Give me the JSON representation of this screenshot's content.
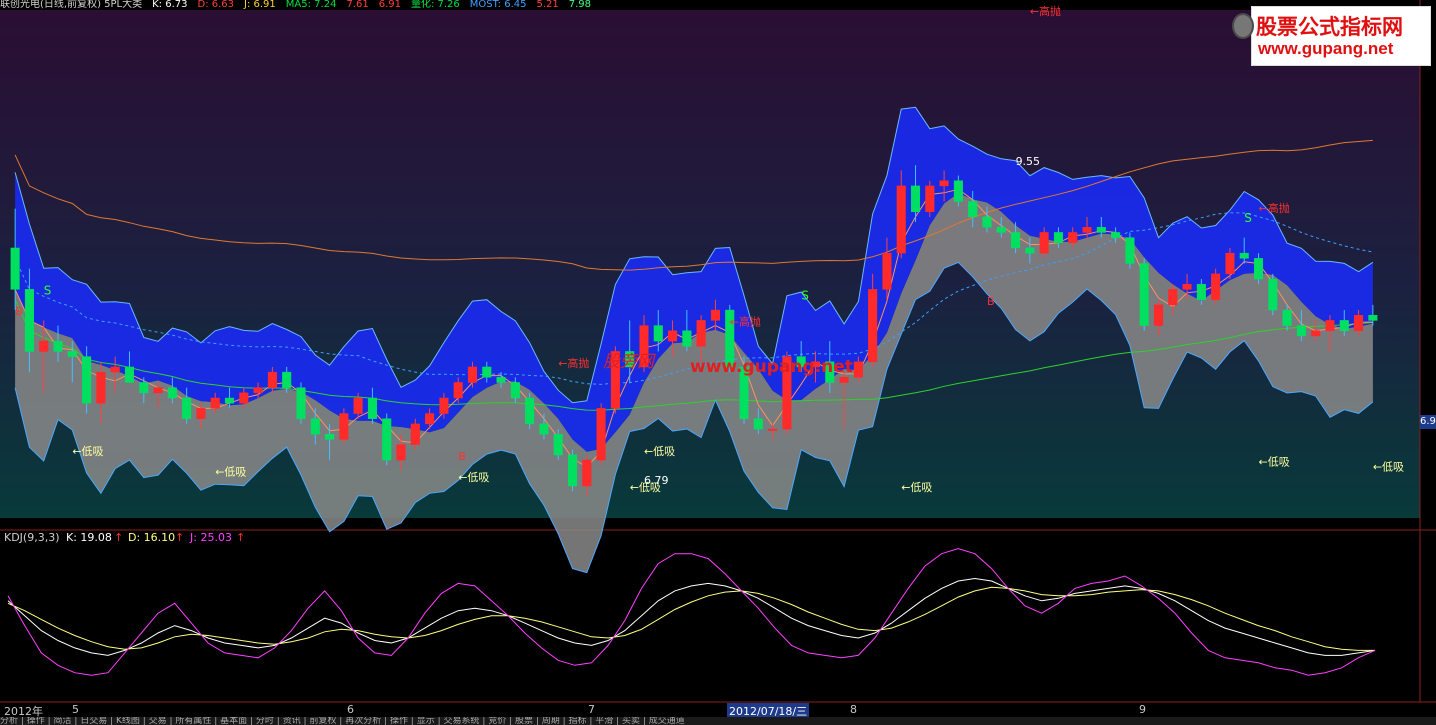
{
  "header": {
    "items": [
      {
        "text": "联创光电(日线,前复权) 5PL大类",
        "color": "#d0d0d0"
      },
      {
        "text": "K: 6.73",
        "color": "#ffffff"
      },
      {
        "text": "D: 6.63",
        "color": "#ff4040"
      },
      {
        "text": "J: 6.91",
        "color": "#ffd040"
      },
      {
        "text": "MA5: 7.24",
        "color": "#00e040"
      },
      {
        "text": "7.61",
        "color": "#ff4040"
      },
      {
        "text": "6.91",
        "color": "#ff4040"
      },
      {
        "text": "量化: 7.26",
        "color": "#00e040"
      },
      {
        "text": "MOST: 6.45",
        "color": "#40a0ff"
      },
      {
        "text": "5.21",
        "color": "#ff4040"
      },
      {
        "text": "7.98",
        "color": "#40ff80"
      }
    ]
  },
  "watermark": {
    "line1": "股票公式指标网",
    "line2": "www.gupang.net"
  },
  "center_watermark": {
    "cn": "股旁网",
    "url": "www.gupang.net"
  },
  "price_box": "6.9",
  "axis_labels": [
    {
      "text": "2012年"
    },
    {
      "text": "5"
    },
    {
      "text": "6"
    },
    {
      "text": "7"
    },
    {
      "text": "2012/07/18/三",
      "highlight": true
    },
    {
      "text": "8"
    },
    {
      "text": "9"
    }
  ],
  "bottom_bar": "分析 | 操作 | 简洁 | 日交易 | K线图 | 交易 | 所有属性 | 基本面 | 分时 | 资讯 | 前复权 | 再次分析 | 操作 | 显示 | 交易系统 | 竞价 | 股票 | 周期 | 指标 | 平滑 | 买卖 | 成交通道",
  "kdj": {
    "title": "KDJ(9,3,3)",
    "k_label": "K: 19.08",
    "k_color": "#ffffff",
    "d_label": "D: 16.10",
    "d_color": "#ffff80",
    "j_label": "J: 25.03",
    "j_color": "#ff40ff",
    "up_arrow": "↑"
  },
  "chart_data": [
    {
      "type": "line",
      "subtype": "candlestick",
      "title": "联创光电(日线,前复权)",
      "note_values": "price series estimated from screenshot",
      "candles": [
        [
          7.6,
          7.98,
          7.0,
          7.2
        ],
        [
          7.2,
          7.4,
          6.4,
          6.6
        ],
        [
          6.6,
          6.9,
          6.2,
          6.7
        ],
        [
          6.7,
          6.85,
          6.5,
          6.6
        ],
        [
          6.6,
          6.7,
          6.3,
          6.55
        ],
        [
          6.55,
          6.65,
          6.0,
          6.1
        ],
        [
          6.1,
          6.5,
          5.9,
          6.4
        ],
        [
          6.4,
          6.55,
          6.2,
          6.45
        ],
        [
          6.45,
          6.6,
          6.3,
          6.3
        ],
        [
          6.3,
          6.35,
          6.1,
          6.2
        ],
        [
          6.2,
          6.3,
          6.05,
          6.25
        ],
        [
          6.25,
          6.35,
          6.1,
          6.15
        ],
        [
          6.15,
          6.25,
          5.9,
          5.95
        ],
        [
          5.95,
          6.1,
          5.85,
          6.05
        ],
        [
          6.05,
          6.2,
          6.0,
          6.15
        ],
        [
          6.15,
          6.25,
          6.05,
          6.1
        ],
        [
          6.1,
          6.25,
          6.05,
          6.2
        ],
        [
          6.2,
          6.3,
          6.15,
          6.25
        ],
        [
          6.25,
          6.45,
          6.2,
          6.4
        ],
        [
          6.4,
          6.45,
          6.2,
          6.25
        ],
        [
          6.25,
          6.3,
          5.9,
          5.95
        ],
        [
          5.95,
          6.05,
          5.7,
          5.8
        ],
        [
          5.8,
          5.9,
          5.55,
          5.75
        ],
        [
          5.75,
          6.05,
          5.7,
          6.0
        ],
        [
          6.0,
          6.2,
          5.95,
          6.15
        ],
        [
          6.15,
          6.25,
          5.9,
          5.95
        ],
        [
          5.95,
          6.0,
          5.5,
          5.55
        ],
        [
          5.55,
          5.8,
          5.45,
          5.7
        ],
        [
          5.7,
          5.95,
          5.65,
          5.9
        ],
        [
          5.9,
          6.05,
          5.85,
          6.0
        ],
        [
          6.0,
          6.2,
          5.95,
          6.15
        ],
        [
          6.15,
          6.35,
          6.1,
          6.3
        ],
        [
          6.3,
          6.5,
          6.25,
          6.45
        ],
        [
          6.45,
          6.5,
          6.3,
          6.35
        ],
        [
          6.35,
          6.4,
          6.25,
          6.3
        ],
        [
          6.3,
          6.35,
          6.1,
          6.15
        ],
        [
          6.15,
          6.2,
          5.85,
          5.9
        ],
        [
          5.9,
          6.0,
          5.75,
          5.8
        ],
        [
          5.8,
          5.85,
          5.55,
          5.6
        ],
        [
          5.6,
          5.65,
          5.25,
          5.3
        ],
        [
          5.3,
          5.6,
          5.2,
          5.55
        ],
        [
          5.55,
          6.1,
          5.5,
          6.05
        ],
        [
          6.05,
          6.65,
          6.0,
          6.6
        ],
        [
          6.6,
          6.9,
          6.3,
          6.45
        ],
        [
          6.45,
          6.95,
          6.4,
          6.85
        ],
        [
          6.85,
          7.0,
          6.6,
          6.7
        ],
        [
          6.7,
          6.9,
          6.55,
          6.8
        ],
        [
          6.8,
          7.0,
          6.6,
          6.65
        ],
        [
          6.65,
          6.95,
          6.5,
          6.9
        ],
        [
          6.9,
          7.1,
          6.8,
          7.0
        ],
        [
          7.0,
          7.05,
          6.4,
          6.45
        ],
        [
          6.45,
          6.55,
          5.9,
          5.95
        ],
        [
          5.95,
          6.05,
          5.8,
          5.85
        ],
        [
          5.85,
          5.9,
          5.75,
          5.85
        ],
        [
          5.85,
          6.6,
          5.8,
          6.55
        ],
        [
          6.55,
          6.7,
          6.4,
          6.45
        ],
        [
          6.45,
          6.6,
          6.3,
          6.5
        ],
        [
          6.5,
          6.7,
          6.2,
          6.3
        ],
        [
          6.3,
          6.4,
          5.85,
          6.35
        ],
        [
          6.35,
          6.55,
          6.3,
          6.5
        ],
        [
          6.5,
          7.35,
          6.45,
          7.2
        ],
        [
          7.2,
          7.7,
          7.1,
          7.55
        ],
        [
          7.55,
          8.35,
          7.5,
          8.2
        ],
        [
          8.2,
          8.4,
          7.85,
          7.95
        ],
        [
          7.95,
          8.25,
          7.9,
          8.2
        ],
        [
          8.2,
          8.35,
          8.05,
          8.25
        ],
        [
          8.25,
          8.3,
          8.0,
          8.05
        ],
        [
          8.05,
          8.15,
          7.8,
          7.9
        ],
        [
          7.9,
          8.0,
          7.75,
          7.8
        ],
        [
          7.8,
          7.9,
          7.7,
          7.75
        ],
        [
          7.75,
          7.85,
          7.55,
          7.6
        ],
        [
          7.6,
          7.7,
          7.45,
          7.55
        ],
        [
          7.55,
          7.8,
          7.5,
          7.75
        ],
        [
          7.75,
          7.8,
          7.6,
          7.65
        ],
        [
          7.65,
          7.8,
          7.6,
          7.75
        ],
        [
          7.75,
          7.9,
          7.7,
          7.8
        ],
        [
          7.8,
          7.9,
          7.7,
          7.75
        ],
        [
          7.75,
          7.8,
          7.65,
          7.7
        ],
        [
          7.7,
          7.75,
          7.4,
          7.45
        ],
        [
          7.45,
          7.5,
          6.8,
          6.85
        ],
        [
          6.85,
          7.1,
          6.75,
          7.05
        ],
        [
          7.05,
          7.25,
          6.95,
          7.2
        ],
        [
          7.2,
          7.35,
          7.1,
          7.25
        ],
        [
          7.25,
          7.3,
          7.05,
          7.1
        ],
        [
          7.1,
          7.4,
          7.05,
          7.35
        ],
        [
          7.35,
          7.6,
          7.3,
          7.55
        ],
        [
          7.55,
          7.7,
          7.45,
          7.5
        ],
        [
          7.5,
          7.55,
          7.25,
          7.3
        ],
        [
          7.3,
          7.35,
          6.95,
          7.0
        ],
        [
          7.0,
          7.05,
          6.8,
          6.85
        ],
        [
          6.85,
          7.0,
          6.7,
          6.75
        ],
        [
          6.75,
          6.9,
          6.7,
          6.8
        ],
        [
          6.8,
          6.95,
          6.6,
          6.9
        ],
        [
          6.9,
          7.0,
          6.75,
          6.8
        ],
        [
          6.8,
          7.0,
          6.75,
          6.95
        ],
        [
          6.95,
          7.05,
          6.85,
          6.9
        ]
      ],
      "annotations": [
        "低吸",
        "低吸",
        "低吸",
        "低吸",
        "低吸",
        "低吸",
        "低吸",
        "低吸",
        "高抛",
        "高抛",
        "高抛",
        "高抛",
        "9.55",
        "6.79",
        "S",
        "B",
        "S",
        "B",
        "S",
        "B"
      ],
      "x_ticks": [
        "2012年",
        "5",
        "6",
        "7",
        "8",
        "9"
      ],
      "grid": false
    },
    {
      "type": "line",
      "title": "KDJ(9,3,3)",
      "series": [
        {
          "name": "K",
          "values": [
            70,
            58,
            46,
            38,
            32,
            28,
            26,
            30,
            36,
            44,
            50,
            46,
            40,
            36,
            34,
            32,
            34,
            40,
            48,
            56,
            52,
            44,
            38,
            36,
            40,
            48,
            56,
            62,
            64,
            62,
            58,
            52,
            46,
            40,
            36,
            34,
            38,
            46,
            58,
            70,
            78,
            82,
            84,
            82,
            78,
            72,
            64,
            56,
            50,
            46,
            42,
            40,
            44,
            52,
            62,
            72,
            80,
            86,
            88,
            86,
            80,
            74,
            70,
            72,
            76,
            78,
            80,
            82,
            80,
            76,
            70,
            62,
            54,
            48,
            44,
            40,
            36,
            32,
            28,
            26,
            26,
            28,
            30
          ]
        },
        {
          "name": "D",
          "values": [
            68,
            62,
            55,
            48,
            42,
            37,
            33,
            31,
            32,
            36,
            41,
            43,
            42,
            40,
            38,
            36,
            35,
            37,
            40,
            45,
            47,
            46,
            43,
            41,
            40,
            42,
            46,
            51,
            55,
            58,
            58,
            56,
            53,
            49,
            45,
            41,
            40,
            42,
            47,
            55,
            63,
            69,
            74,
            77,
            78,
            76,
            72,
            67,
            61,
            56,
            51,
            47,
            46,
            48,
            53,
            59,
            66,
            73,
            78,
            81,
            80,
            78,
            75,
            74,
            74,
            75,
            77,
            78,
            79,
            78,
            75,
            71,
            66,
            60,
            55,
            50,
            46,
            41,
            37,
            33,
            31,
            30,
            30
          ]
        },
        {
          "name": "J",
          "values": [
            74,
            50,
            28,
            18,
            12,
            10,
            12,
            28,
            44,
            60,
            68,
            52,
            36,
            28,
            26,
            24,
            32,
            46,
            64,
            78,
            62,
            40,
            28,
            26,
            40,
            60,
            76,
            84,
            82,
            70,
            58,
            44,
            32,
            22,
            18,
            20,
            34,
            54,
            80,
            100,
            108,
            108,
            104,
            92,
            78,
            64,
            48,
            34,
            28,
            26,
            24,
            26,
            40,
            60,
            80,
            98,
            108,
            112,
            108,
            96,
            80,
            66,
            60,
            68,
            80,
            84,
            86,
            90,
            82,
            72,
            60,
            44,
            30,
            24,
            22,
            20,
            16,
            14,
            10,
            12,
            16,
            24,
            30
          ]
        }
      ],
      "grid": false
    }
  ]
}
